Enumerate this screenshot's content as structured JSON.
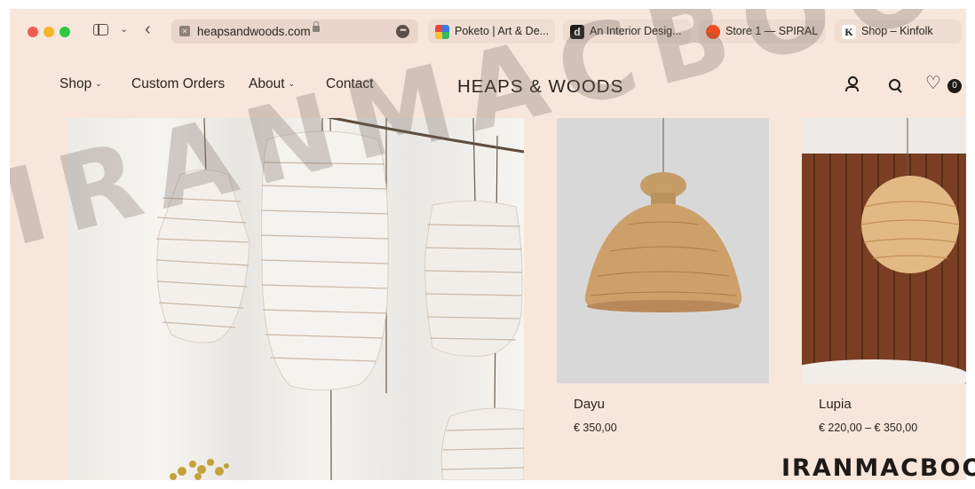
{
  "browser": {
    "url": "heapsandwoods.com",
    "tabs": [
      {
        "title": "Poketo | Art & De...",
        "favicon": "poketo-favicon"
      },
      {
        "title": "An Interior Desig...",
        "favicon": "d-favicon"
      },
      {
        "title": "Store 1 — SPIRAL",
        "favicon": "spiral-favicon"
      },
      {
        "title": "Shop – Kinfolk",
        "favicon": "k-favicon"
      }
    ]
  },
  "site": {
    "nav": {
      "shop": "Shop",
      "custom_orders": "Custom Orders",
      "about": "About",
      "contact": "Contact"
    },
    "logo": "HEAPS & WOODS",
    "wishlist_count": "0",
    "colors": {
      "background": "#f8e6da",
      "text": "#2a2420"
    }
  },
  "products": [
    {
      "name": "Dayu",
      "price": "€ 350,00"
    },
    {
      "name": "Lupia",
      "price": "€ 220,00 – € 350,00"
    }
  ],
  "watermark": {
    "overlay": "IRANMACBOOK",
    "corner": "IRANMACBOOK"
  }
}
